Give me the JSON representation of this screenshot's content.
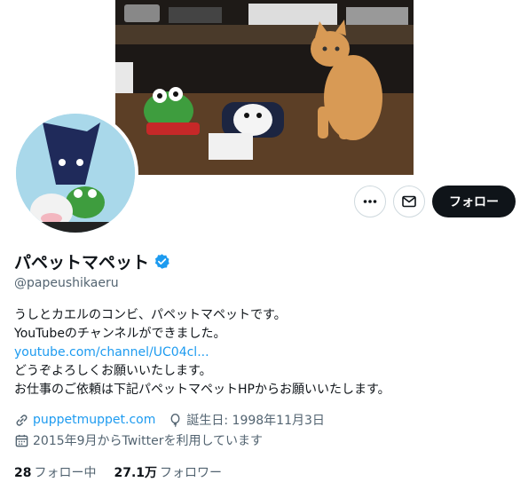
{
  "profile": {
    "display_name": "パペットマペット",
    "handle": "@papeushikaeru",
    "bio_line1": "うしとカエルのコンビ、パペットマペットです。",
    "bio_line2": "YouTubeのチャンネルができました。",
    "bio_link": "youtube.com/channel/UC04cl...",
    "bio_line3": "どうぞよろしくお願いいたします。",
    "bio_line4": "お仕事のご依頼は下記パペットマペットHPからお願いいたします。"
  },
  "meta": {
    "website": "puppetmuppet.com",
    "birthday": "誕生日: 1998年11月3日",
    "joined": "2015年9月からTwitterを利用しています"
  },
  "stats": {
    "following_count": "28",
    "following_label": "フォロー中",
    "followers_count": "27.1万",
    "followers_label": "フォロワー"
  },
  "actions": {
    "follow_label": "フォロー"
  },
  "icons": {
    "more": "more-icon",
    "mail": "mail-icon",
    "verified": "verified-badge-icon",
    "link": "link-icon",
    "birthday": "balloon-icon",
    "calendar": "calendar-icon"
  },
  "colors": {
    "accent": "#1d9bf0",
    "text": "#0f1419",
    "secondary": "#536471",
    "follow_bg": "#0f1419"
  }
}
